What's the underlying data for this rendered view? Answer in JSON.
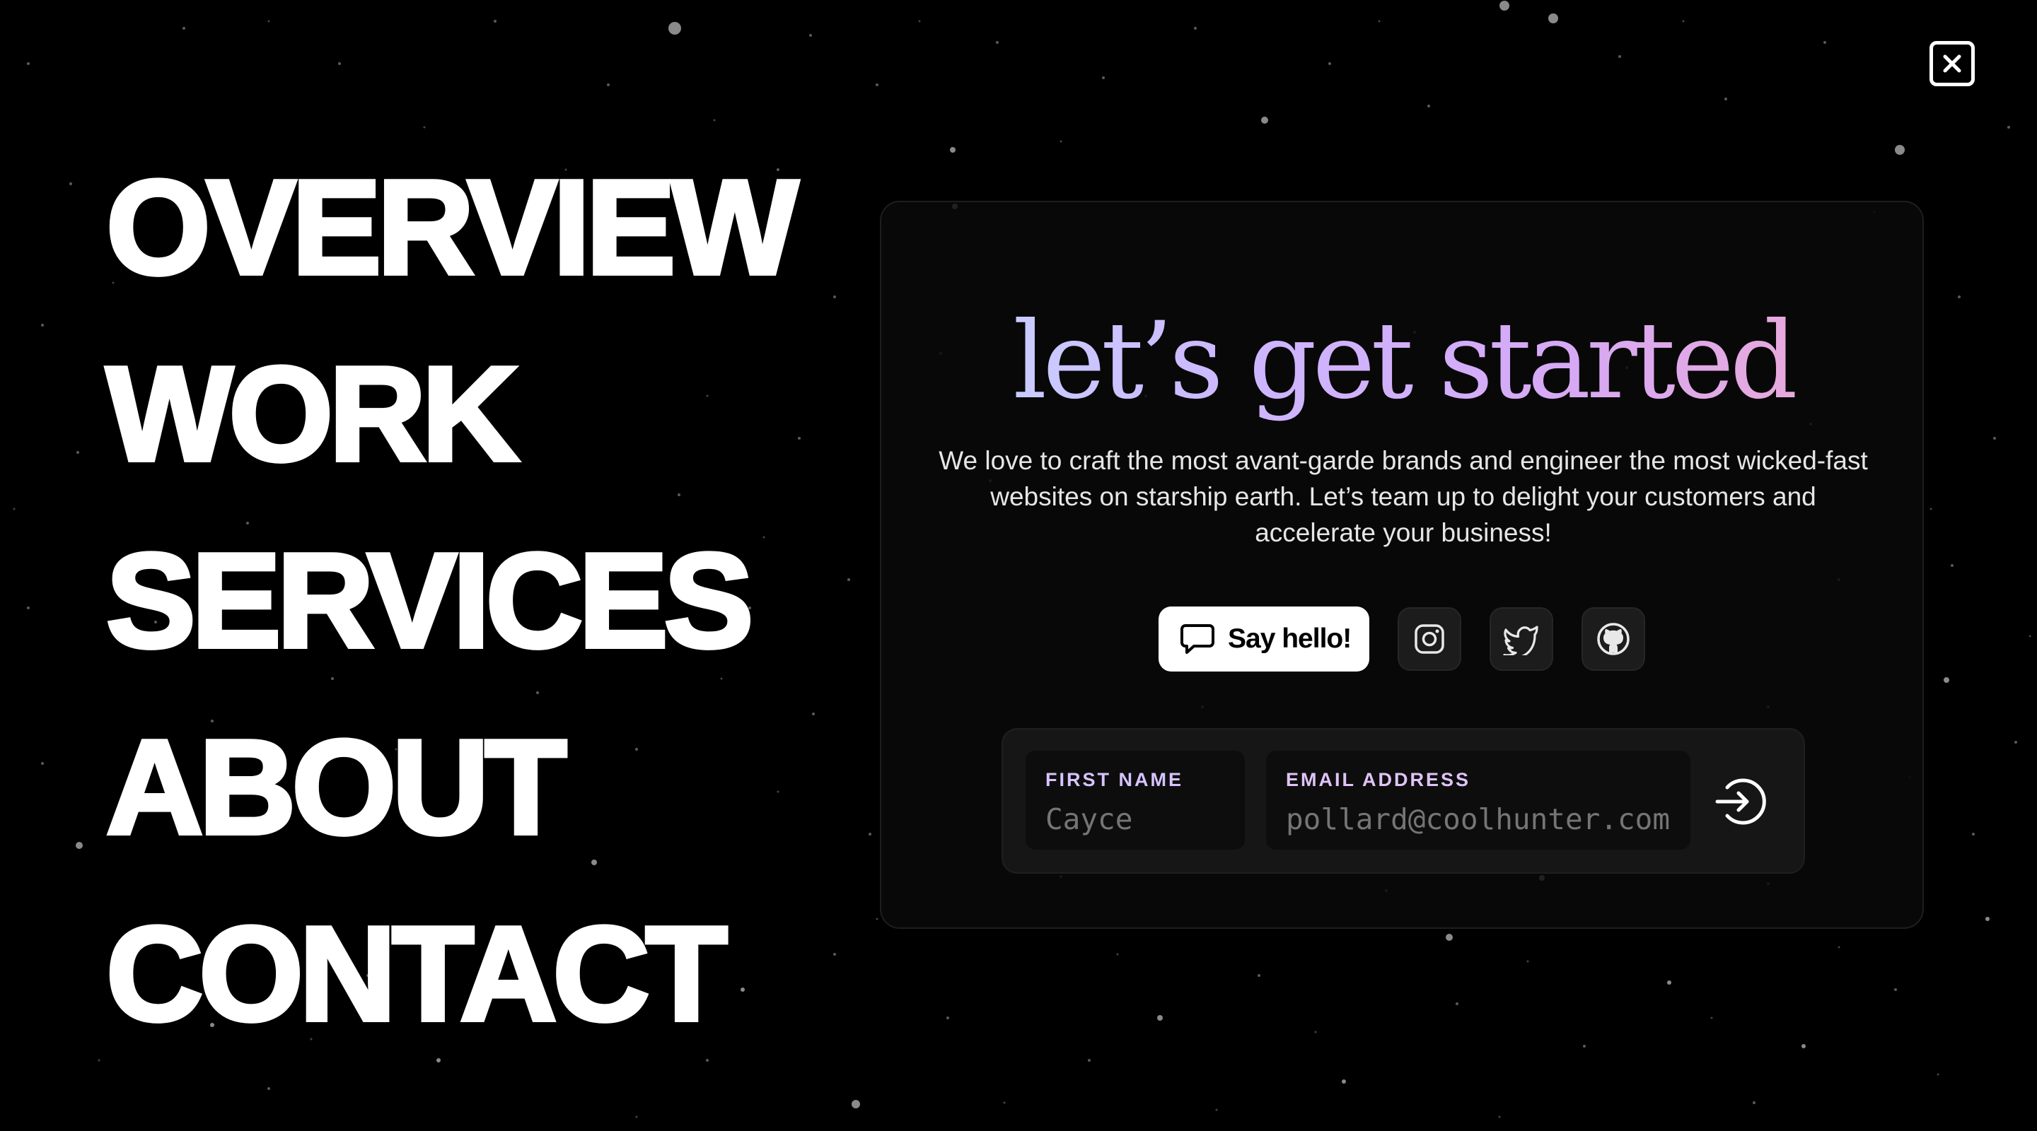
{
  "nav": {
    "items": [
      {
        "label": "OVERVIEW"
      },
      {
        "label": "WORK"
      },
      {
        "label": "SERVICES"
      },
      {
        "label": "ABOUT"
      },
      {
        "label": "CONTACT"
      }
    ]
  },
  "close": {
    "icon": "close-icon"
  },
  "card": {
    "headline": "let’s get started",
    "description": "We love to craft the most avant-garde brands and engineer the most wicked-fast websites on starship earth. Let’s team up to delight your customers and accelerate your business!",
    "hello_button": {
      "label": "Say hello!",
      "icon": "chat-bubble-icon"
    },
    "social": [
      {
        "icon": "instagram-icon"
      },
      {
        "icon": "twitter-icon"
      },
      {
        "icon": "github-icon"
      }
    ],
    "form": {
      "first_name": {
        "label": "FIRST NAME",
        "placeholder": "Cayce"
      },
      "email": {
        "label": "EMAIL ADDRESS",
        "placeholder": "pollard@coolhunter.com"
      },
      "submit_icon": "sign-in-arrow-icon"
    }
  },
  "colors": {
    "background": "#000000",
    "text": "#ffffff",
    "gradient_start": "#c7d8ff",
    "gradient_mid": "#cdb6ff",
    "gradient_end": "#f0a9cf",
    "field_label": "#d7c3ff"
  }
}
